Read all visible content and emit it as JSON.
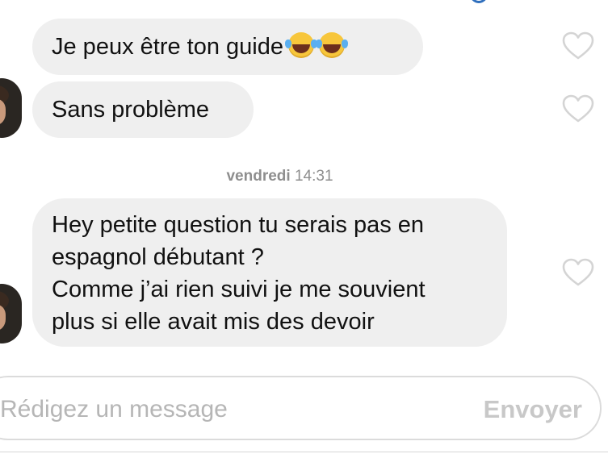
{
  "conversation": {
    "messages": [
      {
        "text": "Je peux être ton guide",
        "emojis": [
          "face-with-tears-of-joy",
          "face-with-tears-of-joy"
        ],
        "icon": "heart-outline-icon"
      },
      {
        "text": "Sans problème",
        "icon": "heart-outline-icon"
      },
      {
        "text": "Hey petite question tu serais pas en\nespagnol débutant ?\nComme j’ai rien suivi je me souvient\nplus si elle avait mis des devoir",
        "icon": "heart-outline-icon"
      }
    ],
    "separator": {
      "day": "vendredi",
      "time": "14:31"
    }
  },
  "composer": {
    "placeholder": "Rédigez un message",
    "send_label": "Envoyer"
  },
  "colors": {
    "bubble": "#efefef",
    "placeholder": "#b6b6b6",
    "send_disabled": "#c8c8c8",
    "timestamp": "#8e8e8e"
  }
}
